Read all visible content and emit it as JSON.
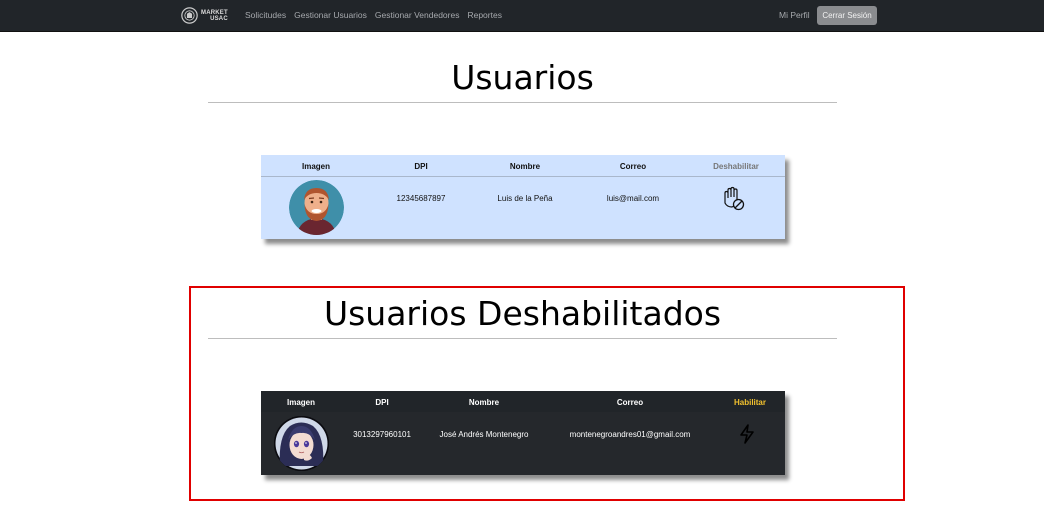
{
  "navbar": {
    "brand": {
      "line1": "MARKET",
      "line2": "USAC",
      "icon": "market-logo-icon"
    },
    "links": [
      "Solicitudes",
      "Gestionar Usuarios",
      "Gestionar Vendedores",
      "Reportes"
    ],
    "profile_label": "Mi Perfil",
    "logout_label": "Cerrar Sesión"
  },
  "users_section": {
    "title": "Usuarios",
    "table": {
      "headers": [
        "Imagen",
        "DPI",
        "Nombre",
        "Correo",
        "Deshabilitar"
      ],
      "rows": [
        {
          "dpi": "12345687897",
          "nombre": "Luis de la Peña",
          "correo": "luis@mail.com",
          "avatar": "bearded-man-avatar",
          "action_icon": "hand-stop-icon"
        }
      ]
    }
  },
  "disabled_section": {
    "title": "Usuarios Deshabilitados",
    "table": {
      "headers": [
        "Imagen",
        "DPI",
        "Nombre",
        "Correo",
        "Habilitar"
      ],
      "rows": [
        {
          "dpi": "3013297960101",
          "nombre": "José Andrés Montenegro",
          "correo": "montenegroandres01@gmail.com",
          "avatar": "anime-girl-avatar",
          "action_icon": "lightning-bolt-icon"
        }
      ]
    }
  },
  "colors": {
    "navbar": "#212529",
    "light_table": "#cfe2ff",
    "dark_table": "#25282c",
    "enable_header": "#f2c12e",
    "highlight": "#e00000"
  }
}
